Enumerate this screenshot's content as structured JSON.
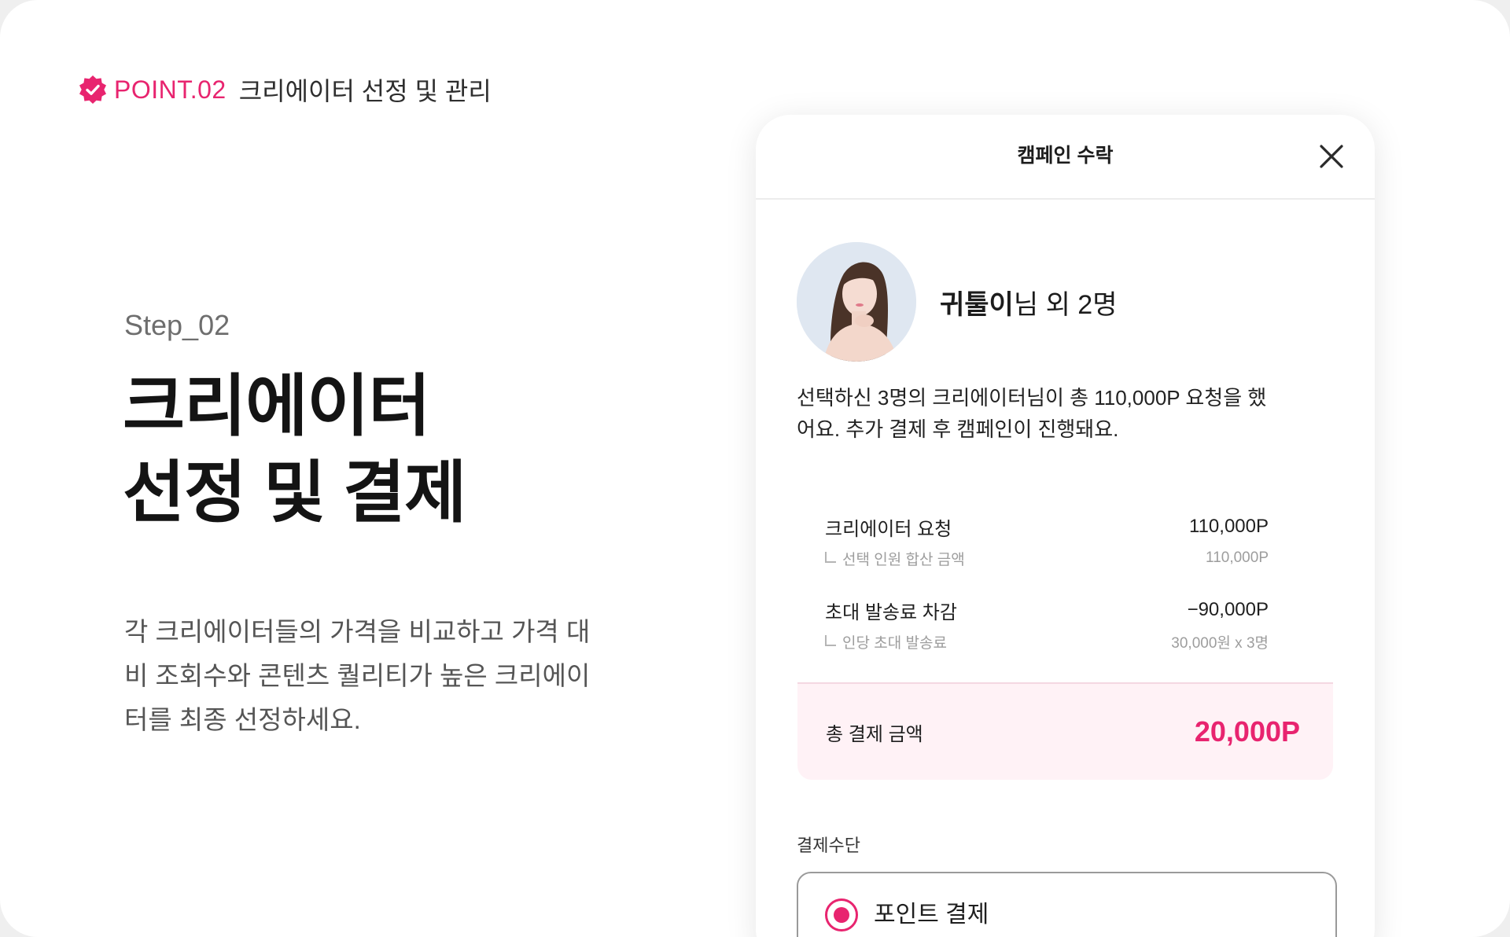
{
  "point": {
    "label": "POINT.02",
    "title": "크리에이터 선정 및 관리"
  },
  "step": "Step_02",
  "headline": [
    "크리에이터",
    "선정 및 결제"
  ],
  "description": [
    "각 크리에이터들의 가격을 비교하고 가격 대",
    "비 조회수와 콘텐츠 퀄리티가 높은 크리에이",
    "터를 최종 선정하세요."
  ],
  "modal": {
    "title": "캠페인 수락",
    "creator_name": "귀툴이",
    "creator_suffix": "님 외 2명",
    "message": [
      "선택하신 3명의 크리에이터님이 총 110,000P 요청을 했",
      "어요. 추가 결제 후 캠페인이 진행돼요."
    ],
    "rows": [
      {
        "label": "크리에이터 요청",
        "value": "110,000P",
        "sub_label": "선택 인원 합산 금액",
        "sub_value": "110,000P"
      },
      {
        "label": "초대 발송료 차감",
        "value": "−90,000P",
        "sub_label": "인당 초대 발송료",
        "sub_value": "30,000원 x 3명"
      }
    ],
    "total_label": "총 결제 금액",
    "total_value": "20,000P",
    "payment_label": "결제수단",
    "payment_option": "포인트 결제"
  },
  "colors": {
    "accent": "#e8246f",
    "total_bg": "#fff2f6"
  },
  "icons": {
    "badge": "verified-badge-icon",
    "close": "close-icon",
    "radio": "radio-selected-icon"
  }
}
